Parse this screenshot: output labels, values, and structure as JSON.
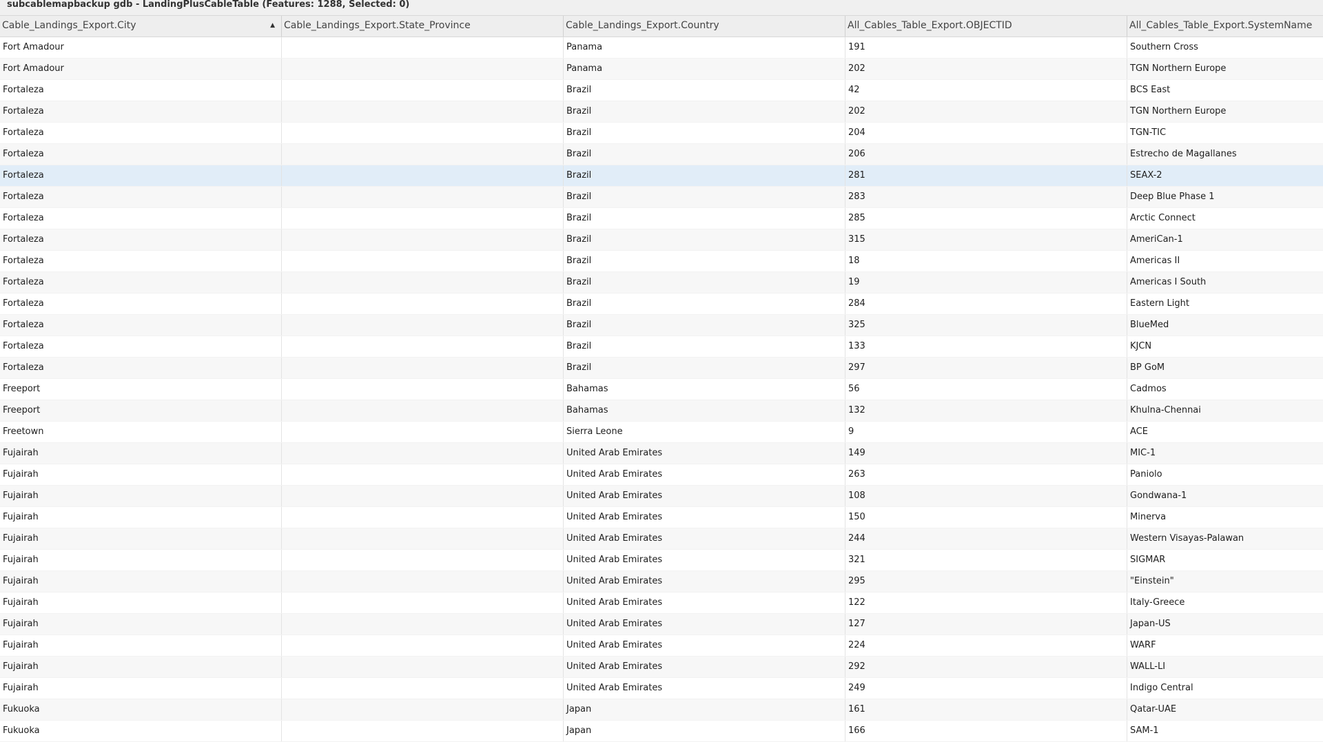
{
  "window": {
    "title": "subcablemapbackup gdb - LandingPlusCableTable (Features: 1288, Selected: 0)"
  },
  "table": {
    "columns": [
      "Cable_Landings_Export.City",
      "Cable_Landings_Export.State_Province",
      "Cable_Landings_Export.Country",
      "All_Cables_Table_Export.OBJECTID",
      "All_Cables_Table_Export.SystemName"
    ],
    "sort": {
      "column": 0,
      "direction": "ascending",
      "icon": "sort-ascending-icon"
    },
    "highlight_row": 6,
    "rows": [
      [
        "Fort Amadour",
        "",
        "Panama",
        "191",
        "Southern Cross"
      ],
      [
        "Fort Amadour",
        "",
        "Panama",
        "202",
        "TGN Northern Europe"
      ],
      [
        "Fortaleza",
        "",
        "Brazil",
        "42",
        "BCS East"
      ],
      [
        "Fortaleza",
        "",
        "Brazil",
        "202",
        "TGN Northern Europe"
      ],
      [
        "Fortaleza",
        "",
        "Brazil",
        "204",
        "TGN-TIC"
      ],
      [
        "Fortaleza",
        "",
        "Brazil",
        "206",
        "Estrecho de Magallanes"
      ],
      [
        "Fortaleza",
        "",
        "Brazil",
        "281",
        "SEAX-2"
      ],
      [
        "Fortaleza",
        "",
        "Brazil",
        "283",
        "Deep Blue Phase 1"
      ],
      [
        "Fortaleza",
        "",
        "Brazil",
        "285",
        "Arctic Connect"
      ],
      [
        "Fortaleza",
        "",
        "Brazil",
        "315",
        "AmeriCan-1"
      ],
      [
        "Fortaleza",
        "",
        "Brazil",
        "18",
        "Americas II"
      ],
      [
        "Fortaleza",
        "",
        "Brazil",
        "19",
        "Americas I South"
      ],
      [
        "Fortaleza",
        "",
        "Brazil",
        "284",
        "Eastern Light"
      ],
      [
        "Fortaleza",
        "",
        "Brazil",
        "325",
        "BlueMed"
      ],
      [
        "Fortaleza",
        "",
        "Brazil",
        "133",
        "KJCN"
      ],
      [
        "Fortaleza",
        "",
        "Brazil",
        "297",
        "BP GoM"
      ],
      [
        "Freeport",
        "",
        "Bahamas",
        "56",
        "Cadmos"
      ],
      [
        "Freeport",
        "",
        "Bahamas",
        "132",
        "Khulna-Chennai"
      ],
      [
        "Freetown",
        "",
        "Sierra Leone",
        "9",
        "ACE"
      ],
      [
        "Fujairah",
        "",
        "United Arab Emirates",
        "149",
        "MIC-1"
      ],
      [
        "Fujairah",
        "",
        "United Arab Emirates",
        "263",
        "Paniolo"
      ],
      [
        "Fujairah",
        "",
        "United Arab Emirates",
        "108",
        "Gondwana-1"
      ],
      [
        "Fujairah",
        "",
        "United Arab Emirates",
        "150",
        "Minerva"
      ],
      [
        "Fujairah",
        "",
        "United Arab Emirates",
        "244",
        "Western Visayas-Palawan"
      ],
      [
        "Fujairah",
        "",
        "United Arab Emirates",
        "321",
        "SIGMAR"
      ],
      [
        "Fujairah",
        "",
        "United Arab Emirates",
        "295",
        "\"Einstein\""
      ],
      [
        "Fujairah",
        "",
        "United Arab Emirates",
        "122",
        "Italy-Greece"
      ],
      [
        "Fujairah",
        "",
        "United Arab Emirates",
        "127",
        "Japan-US"
      ],
      [
        "Fujairah",
        "",
        "United Arab Emirates",
        "224",
        "WARF"
      ],
      [
        "Fujairah",
        "",
        "United Arab Emirates",
        "292",
        "WALL-LI"
      ],
      [
        "Fujairah",
        "",
        "United Arab Emirates",
        "249",
        "Indigo Central"
      ],
      [
        "Fukuoka",
        "",
        "Japan",
        "161",
        "Qatar-UAE"
      ],
      [
        "Fukuoka",
        "",
        "Japan",
        "166",
        "SAM-1"
      ]
    ]
  }
}
